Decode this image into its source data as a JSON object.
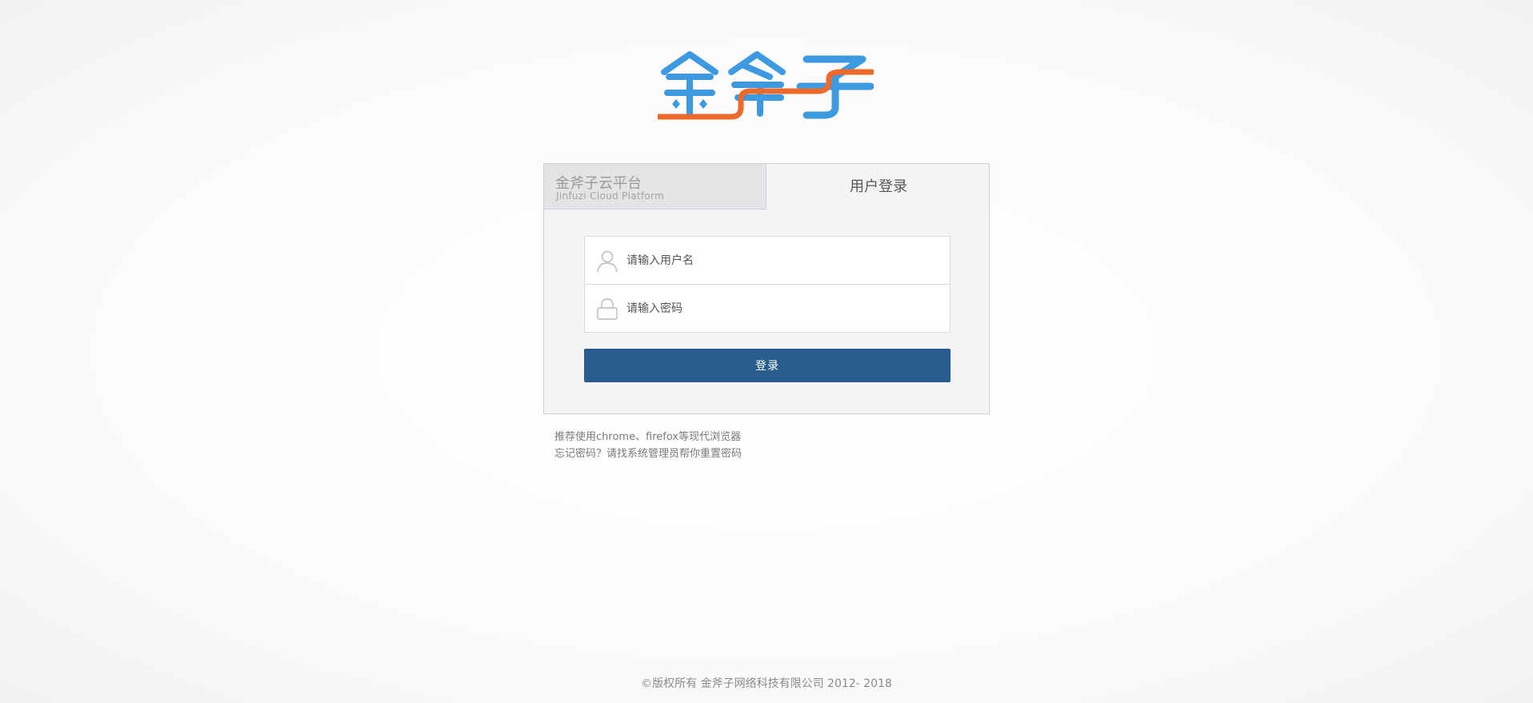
{
  "brand": {
    "logo_text": "金斧子",
    "colors": {
      "blue": "#3d9ae0",
      "orange": "#ec6a2c"
    }
  },
  "tabs": {
    "platform_name": "金斧子云平台",
    "platform_subtitle": "Jinfuzi Cloud Platform",
    "login_label": "用户登录"
  },
  "form": {
    "username_placeholder": "请输入用户名",
    "password_placeholder": "请输入密码",
    "username_icon": "user-icon",
    "password_icon": "lock-icon",
    "submit_label": "登录",
    "button_color": "#285e8e"
  },
  "tips": {
    "browser": "推荐使用chrome、firefox等现代浏览器",
    "forgot": "忘记密码？请找系统管理员帮你重置密码"
  },
  "footer": {
    "copyright": "©版权所有 金斧子网络科技有限公司 2012- 2018"
  }
}
